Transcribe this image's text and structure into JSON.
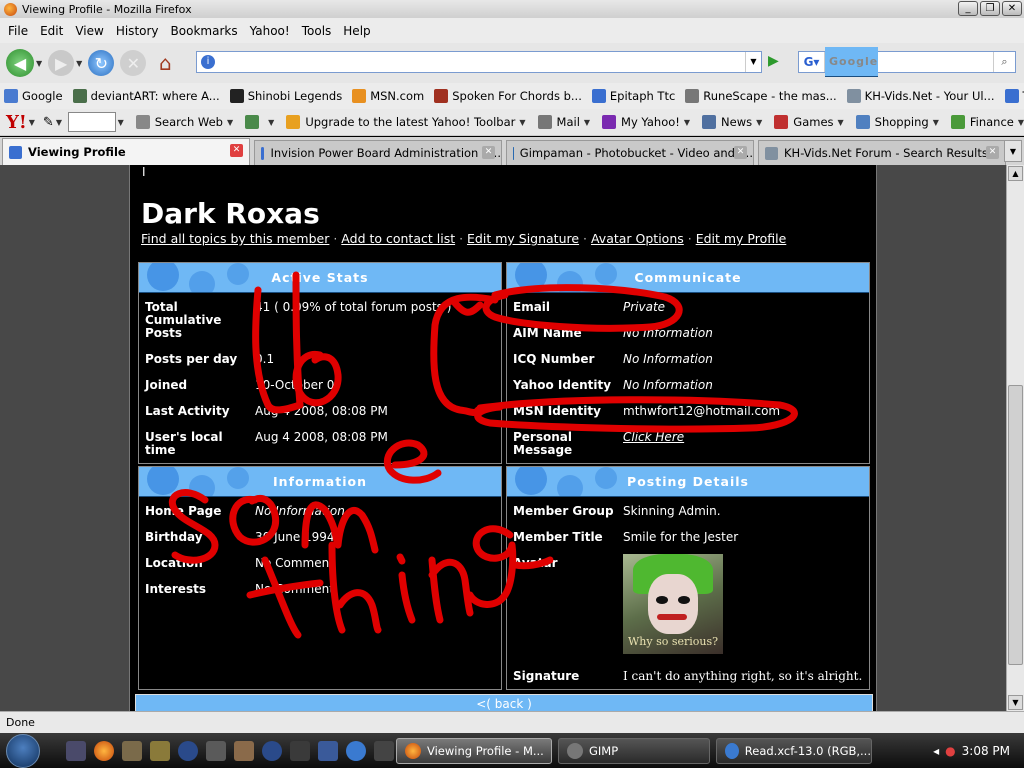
{
  "window": {
    "title": "Viewing Profile - Mozilla Firefox"
  },
  "menu": [
    "File",
    "Edit",
    "View",
    "History",
    "Bookmarks",
    "Yahoo!",
    "Tools",
    "Help"
  ],
  "search": {
    "placeholder": "Google"
  },
  "bookmarks": [
    {
      "label": "Google",
      "icon": "google-icon",
      "color": "#4a7bd0"
    },
    {
      "label": "deviantART: where A...",
      "icon": "deviantart-icon",
      "color": "#4a6e4a"
    },
    {
      "label": "Shinobi Legends",
      "icon": "shinobi-icon",
      "color": "#222"
    },
    {
      "label": "MSN.com",
      "icon": "msn-butterfly-icon",
      "color": "#e89020"
    },
    {
      "label": "Spoken For Chords b...",
      "icon": "guitar-icon",
      "color": "#a03020"
    },
    {
      "label": "Epitaph Ttc",
      "icon": "info-icon",
      "color": "#3a6fd0"
    },
    {
      "label": "RuneScape - the mas...",
      "icon": "sword-icon",
      "color": "#777"
    },
    {
      "label": "KH-Vids.Net - Your Ul...",
      "icon": "page-icon",
      "color": "#8090a0"
    },
    {
      "label": "Teens' Midnight",
      "icon": "info-icon",
      "color": "#3a6fd0"
    }
  ],
  "yahoo": {
    "logo": "Y!",
    "items": [
      {
        "label": "Search Web",
        "icon": "search-web-icon",
        "color": "#888"
      },
      {
        "label": "",
        "icon": "shield-icon",
        "color": "#4a8a4a"
      },
      {
        "label": "Upgrade to the latest Yahoo! Toolbar",
        "icon": "warning-icon",
        "color": "#e8a020"
      },
      {
        "label": "Mail",
        "icon": "mail-icon",
        "color": "#777"
      },
      {
        "label": "My Yahoo!",
        "icon": "my-yahoo-icon",
        "color": "#7a2ab0"
      },
      {
        "label": "News",
        "icon": "news-icon",
        "color": "#5070a0"
      },
      {
        "label": "Games",
        "icon": "games-icon",
        "color": "#c03030"
      },
      {
        "label": "Shopping",
        "icon": "shopping-cart-icon",
        "color": "#5080c0"
      },
      {
        "label": "Finance",
        "icon": "finance-icon",
        "color": "#4a9a3a"
      }
    ]
  },
  "tabs": [
    {
      "label": "Viewing Profile",
      "active": true,
      "color": "#3a6fd0"
    },
    {
      "label": "Invision Power Board Administration C...",
      "active": false,
      "color": "#3a6fd0"
    },
    {
      "label": "Gimpaman - Photobucket - Video and I...",
      "active": false,
      "color": "#2a6ab0"
    },
    {
      "label": "KH-Vids.Net Forum - Search Results",
      "active": false,
      "color": "#8090a0"
    }
  ],
  "profile": {
    "name": "Dark Roxas",
    "links": [
      "Find all topics by this member",
      "Add to contact list",
      "Edit my Signature",
      "Avatar Options",
      "Edit my Profile"
    ],
    "sep": " · ",
    "active_stats": {
      "title": "Active Stats",
      "rows": [
        {
          "k": "Total Cumulative Posts",
          "v": "41 ( 0.09% of total forum posts )"
        },
        {
          "k": "Posts per day",
          "v": "0.1"
        },
        {
          "k": "Joined",
          "v": "10-October 07"
        },
        {
          "k": "Last Activity",
          "v": "Aug 4 2008, 08:08 PM"
        },
        {
          "k": "User's local time",
          "v": "Aug 4 2008, 08:08 PM"
        }
      ]
    },
    "communicate": {
      "title": "Communicate",
      "rows": [
        {
          "k": "Email",
          "v": "Private"
        },
        {
          "k": "AIM Name",
          "v": "No Information"
        },
        {
          "k": "ICQ Number",
          "v": "No Information"
        },
        {
          "k": "Yahoo Identity",
          "v": "No Information"
        },
        {
          "k": "MSN Identity",
          "v": "mthwfort12@hotmail.com"
        },
        {
          "k": "Personal Message",
          "v": "Click Here"
        }
      ]
    },
    "information": {
      "title": "Information",
      "rows": [
        {
          "k": "Home Page",
          "v": "No Information"
        },
        {
          "k": "Birthday",
          "v": "30 June 1994"
        },
        {
          "k": "Location",
          "v": "No Comment"
        },
        {
          "k": "Interests",
          "v": "No Comment"
        }
      ]
    },
    "posting": {
      "title": "Posting Details",
      "rows": [
        {
          "k": "Member Group",
          "v": "Skinning Admin."
        },
        {
          "k": "Member Title",
          "v": "Smile for the Jester"
        },
        {
          "k": "Avatar",
          "v": ""
        },
        {
          "k": "Signature",
          "v": "I can't do anything right, so it's alright."
        }
      ],
      "avatar_caption": "Why so serious?"
    },
    "back": "<( back )"
  },
  "status": "Done",
  "taskbar": {
    "tasks": [
      "Viewing Profile - M...",
      "GIMP",
      "Read.xcf-13.0 (RGB,..."
    ],
    "clock": "3:08 PM"
  },
  "colors": {
    "accent": "#6fb8f5",
    "annotation": "#e00000"
  }
}
